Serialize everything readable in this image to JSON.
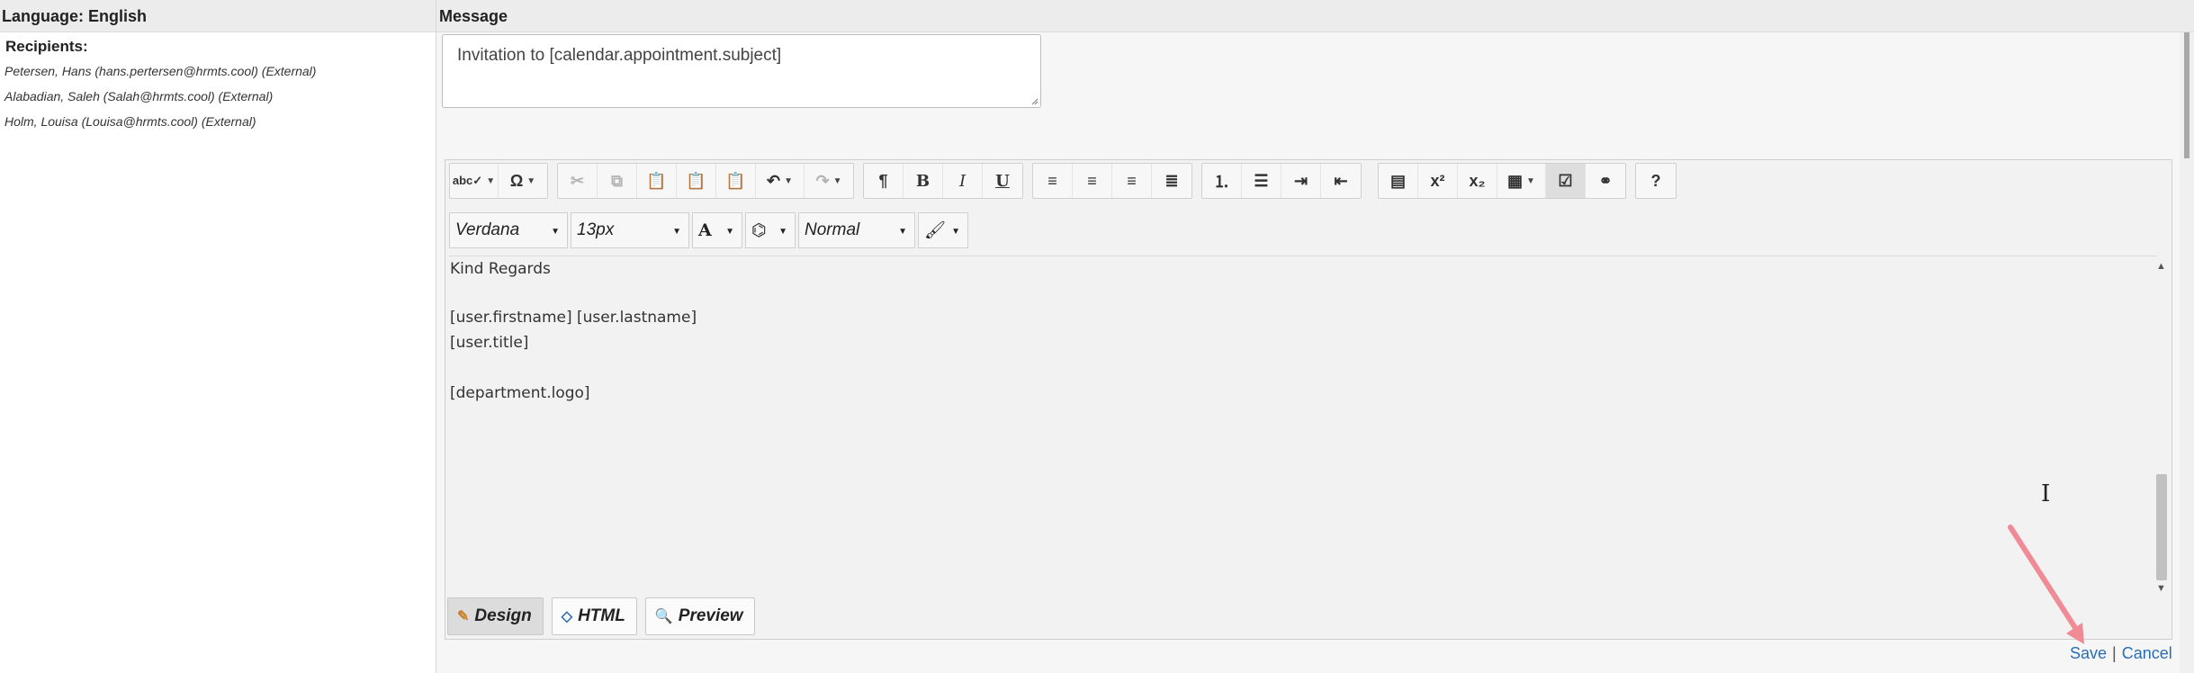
{
  "header": {
    "language_label": "Language: English",
    "message_label": "Message"
  },
  "recipients": {
    "title": "Recipients:",
    "items": [
      "Petersen, Hans (hans.pertersen@hrmts.cool) (External)",
      "Alabadian, Saleh (Salah@hrmts.cool) (External)",
      "Holm, Louisa (Louisa@hrmts.cool) (External)"
    ]
  },
  "subject": {
    "value": "Invitation to [calendar.appointment.subject]"
  },
  "toolbar": {
    "icons": {
      "spellcheck": "spellcheck-icon",
      "special_char": "omega-icon",
      "cut": "cut-icon",
      "copy": "copy-icon",
      "paste": "paste-icon",
      "paste_text": "paste-text-icon",
      "paste_word": "paste-word-icon",
      "undo": "undo-icon",
      "redo": "redo-icon",
      "paragraph": "paragraph-icon",
      "bold": "bold-icon",
      "italic": "italic-icon",
      "underline": "underline-icon",
      "align_left": "align-left-icon",
      "align_center": "align-center-icon",
      "align_right": "align-right-icon",
      "justify": "justify-icon",
      "ordered_list": "ordered-list-icon",
      "bullet_list": "bullet-list-icon",
      "indent": "indent-icon",
      "outdent": "outdent-icon",
      "horizontal_rule": "horizontal-rule-icon",
      "superscript": "superscript-icon",
      "subscript": "subscript-icon",
      "table": "table-icon",
      "format_blocks": "format-blocks-icon",
      "insert_link": "insert-link-icon",
      "help": "help-icon"
    },
    "font_family": "Verdana",
    "font_size": "13px",
    "paragraph_style": "Normal"
  },
  "content": {
    "lines": [
      "Kind Regards",
      "",
      "[user.firstname] [user.lastname]",
      "[user.title]",
      "",
      "[department.logo]"
    ]
  },
  "modes": {
    "design": "Design",
    "html": "HTML",
    "preview": "Preview",
    "active": "Design"
  },
  "footer": {
    "save": "Save",
    "separator": "|",
    "cancel": "Cancel"
  },
  "colors": {
    "link": "#2a6db5",
    "arrow": "#f08a95"
  }
}
